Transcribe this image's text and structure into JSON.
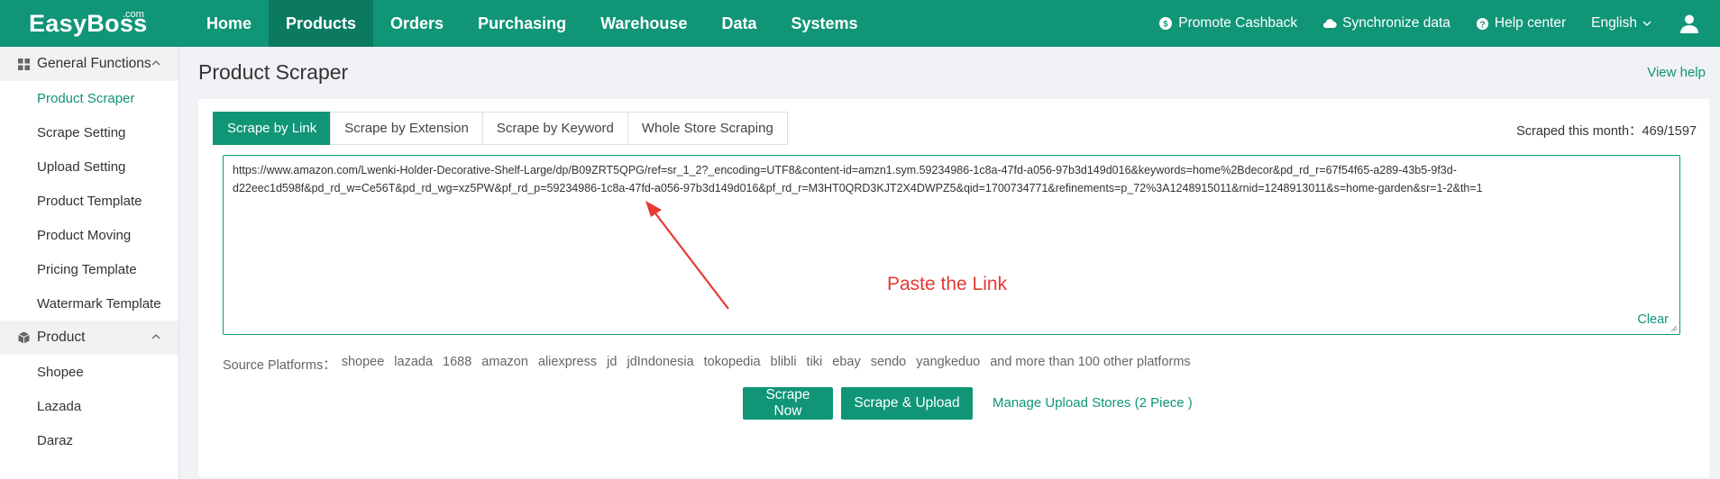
{
  "brand": {
    "name": "EasyBoss",
    "sup": ".com"
  },
  "nav": [
    {
      "label": "Home"
    },
    {
      "label": "Products"
    },
    {
      "label": "Orders"
    },
    {
      "label": "Purchasing"
    },
    {
      "label": "Warehouse"
    },
    {
      "label": "Data"
    },
    {
      "label": "Systems"
    }
  ],
  "top_right": {
    "promote": "Promote Cashback",
    "sync": "Synchronize data",
    "help": "Help center",
    "language": "English"
  },
  "sidebar": {
    "general": {
      "label": "General Functions",
      "items": [
        "Product Scraper",
        "Scrape Setting",
        "Upload Setting",
        "Product Template",
        "Product Moving",
        "Pricing Template",
        "Watermark Template"
      ]
    },
    "product": {
      "label": "Product",
      "items": [
        "Shopee",
        "Lazada",
        "Daraz"
      ]
    }
  },
  "page": {
    "title": "Product Scraper",
    "view_help": "View help"
  },
  "tabs": [
    "Scrape by Link",
    "Scrape by Extension",
    "Scrape by Keyword",
    "Whole Store Scraping"
  ],
  "scraped": {
    "label": "Scraped this month：",
    "value": "469/1597"
  },
  "input": {
    "value": "https://www.amazon.com/Lwenki-Holder-Decorative-Shelf-Large/dp/B09ZRT5QPG/ref=sr_1_2?_encoding=UTF8&content-id=amzn1.sym.59234986-1c8a-47fd-a056-97b3d149d016&keywords=home%2Bdecor&pd_rd_r=67f54f65-a289-43b5-9f3d-d22eec1d598f&pd_rd_w=Ce56T&pd_rd_wg=xz5PW&pf_rd_p=59234986-1c8a-47fd-a056-97b3d149d016&pf_rd_r=M3HT0QRD3KJT2X4DWPZ5&qid=1700734771&refinements=p_72%3A1248915011&rnid=1248913011&s=home-garden&sr=1-2&th=1",
    "clear": "Clear"
  },
  "annotation": {
    "text": "Paste the Link",
    "color": "#e53935"
  },
  "platforms": {
    "label": "Source Platforms：",
    "items": [
      "shopee",
      "lazada",
      "1688",
      "amazon",
      "aliexpress",
      "jd",
      "jdIndonesia",
      "tokopedia",
      "blibli",
      "tiki",
      "ebay",
      "sendo",
      "yangkeduo",
      "and more than 100 other platforms"
    ]
  },
  "actions": {
    "scrape_now": "Scrape Now",
    "scrape_upload": "Scrape & Upload",
    "manage": "Manage Upload Stores (2 Piece )"
  },
  "colors": {
    "brand": "#109577",
    "brand_dark": "#0b7a61",
    "accent_red": "#e53935"
  }
}
